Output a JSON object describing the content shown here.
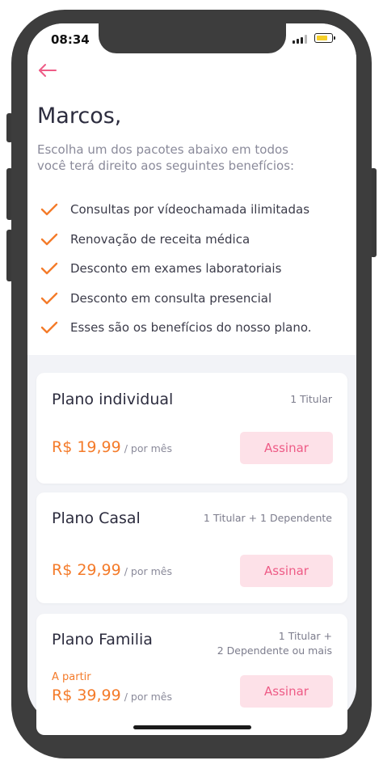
{
  "status_bar": {
    "time": "08:34"
  },
  "greeting": "Marcos,",
  "subtitle": "Escolha um dos pacotes abaixo em todos você terá direito aos seguintes benefícios:",
  "benefits": [
    "Consultas por vídeochamada ilimitadas",
    "Renovação de receita médica",
    "Desconto em exames laboratoriais",
    "Desconto em consulta presencial",
    "Esses são os benefícios do nosso plano."
  ],
  "plans": [
    {
      "name": "Plano individual",
      "meta": "1 Titular",
      "price": "R$ 19,99",
      "per": "/ por mês",
      "cta": "Assinar"
    },
    {
      "name": "Plano Casal",
      "meta": "1 Titular + 1 Dependente",
      "price": "R$ 29,99",
      "per": "/ por mês",
      "cta": "Assinar"
    },
    {
      "name": "Plano Familia",
      "meta_line1": "1 Titular +",
      "meta_line2": "2 Dependente ou mais",
      "from": "A partir",
      "price": "R$ 39,99",
      "per": "/ por mês",
      "cta": "Assinar"
    }
  ],
  "colors": {
    "accent_orange": "#f47b2a",
    "accent_pink": "#ee5b86",
    "button_bg": "#fde1e8",
    "frame": "#3d3d3d"
  },
  "icons": {
    "back": "arrow-left-icon",
    "check": "check-icon",
    "signal": "signal-icon",
    "battery": "battery-icon"
  }
}
